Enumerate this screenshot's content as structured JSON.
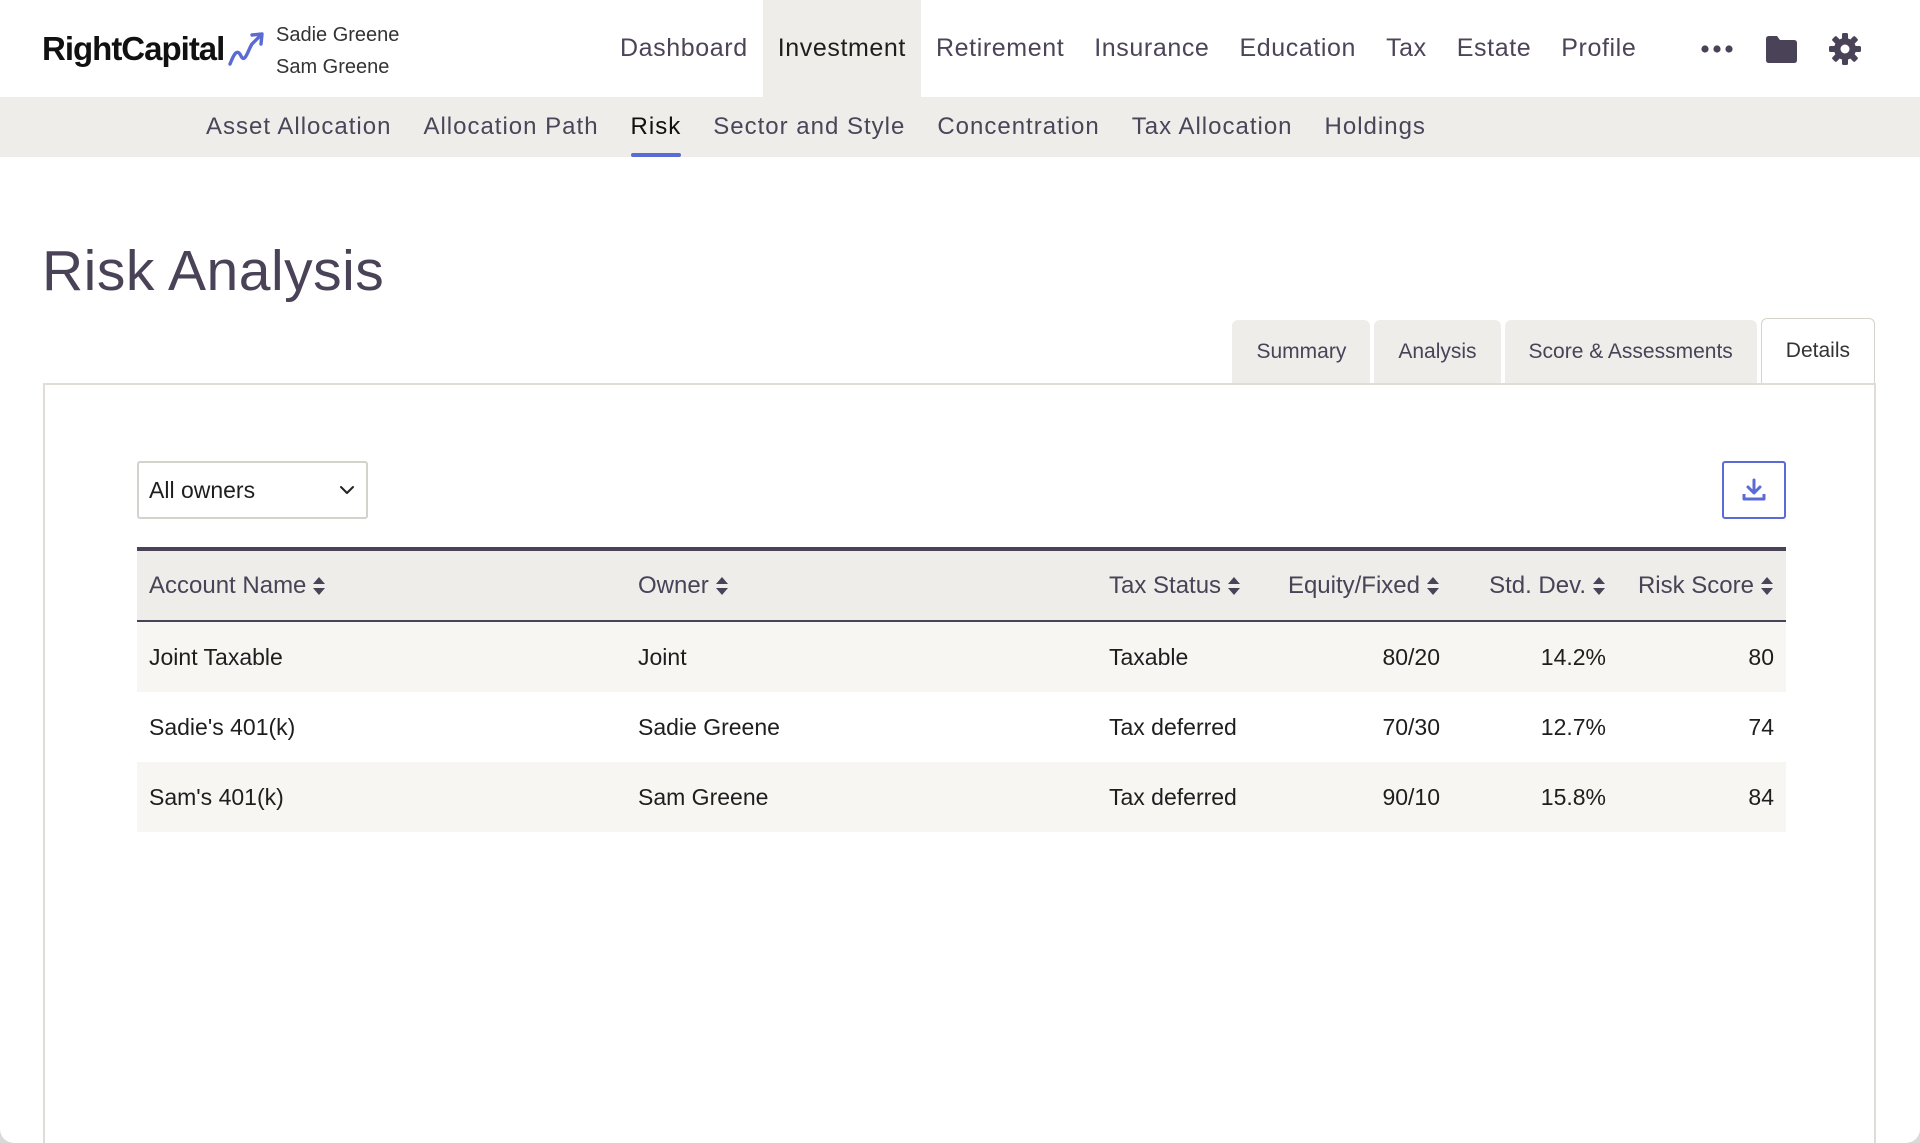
{
  "brand": {
    "name": "RightCapital"
  },
  "clients": [
    "Sadie Greene",
    "Sam Greene"
  ],
  "main_nav": [
    {
      "label": "Dashboard",
      "active": false
    },
    {
      "label": "Investment",
      "active": true
    },
    {
      "label": "Retirement",
      "active": false
    },
    {
      "label": "Insurance",
      "active": false
    },
    {
      "label": "Education",
      "active": false
    },
    {
      "label": "Tax",
      "active": false
    },
    {
      "label": "Estate",
      "active": false
    },
    {
      "label": "Profile",
      "active": false
    }
  ],
  "nav_icons": [
    "more-icon",
    "folder-icon",
    "gear-icon"
  ],
  "sub_nav": [
    {
      "label": "Asset Allocation",
      "active": false
    },
    {
      "label": "Allocation Path",
      "active": false
    },
    {
      "label": "Risk",
      "active": true
    },
    {
      "label": "Sector and Style",
      "active": false
    },
    {
      "label": "Concentration",
      "active": false
    },
    {
      "label": "Tax Allocation",
      "active": false
    },
    {
      "label": "Holdings",
      "active": false
    }
  ],
  "page": {
    "title": "Risk Analysis"
  },
  "tabs": [
    {
      "label": "Summary",
      "active": false
    },
    {
      "label": "Analysis",
      "active": false
    },
    {
      "label": "Score & Assessments",
      "active": false
    },
    {
      "label": "Details",
      "active": true
    }
  ],
  "filter": {
    "owner_selected": "All owners"
  },
  "table": {
    "columns": [
      "Account Name",
      "Owner",
      "Tax Status",
      "Equity/Fixed",
      "Std. Dev.",
      "Risk Score"
    ],
    "rows": [
      {
        "account": "Joint Taxable",
        "owner": "Joint",
        "tax_status": "Taxable",
        "equity_fixed": "80/20",
        "std_dev": "14.2%",
        "risk_score": "80"
      },
      {
        "account": "Sadie's 401(k)",
        "owner": "Sadie Greene",
        "tax_status": "Tax deferred",
        "equity_fixed": "70/30",
        "std_dev": "12.7%",
        "risk_score": "74"
      },
      {
        "account": "Sam's 401(k)",
        "owner": "Sam Greene",
        "tax_status": "Tax deferred",
        "equity_fixed": "90/10",
        "std_dev": "15.8%",
        "risk_score": "84"
      }
    ]
  },
  "colors": {
    "accent": "#5b6bd6",
    "text_muted": "#4a4257",
    "nav_bg": "#eeedea"
  }
}
